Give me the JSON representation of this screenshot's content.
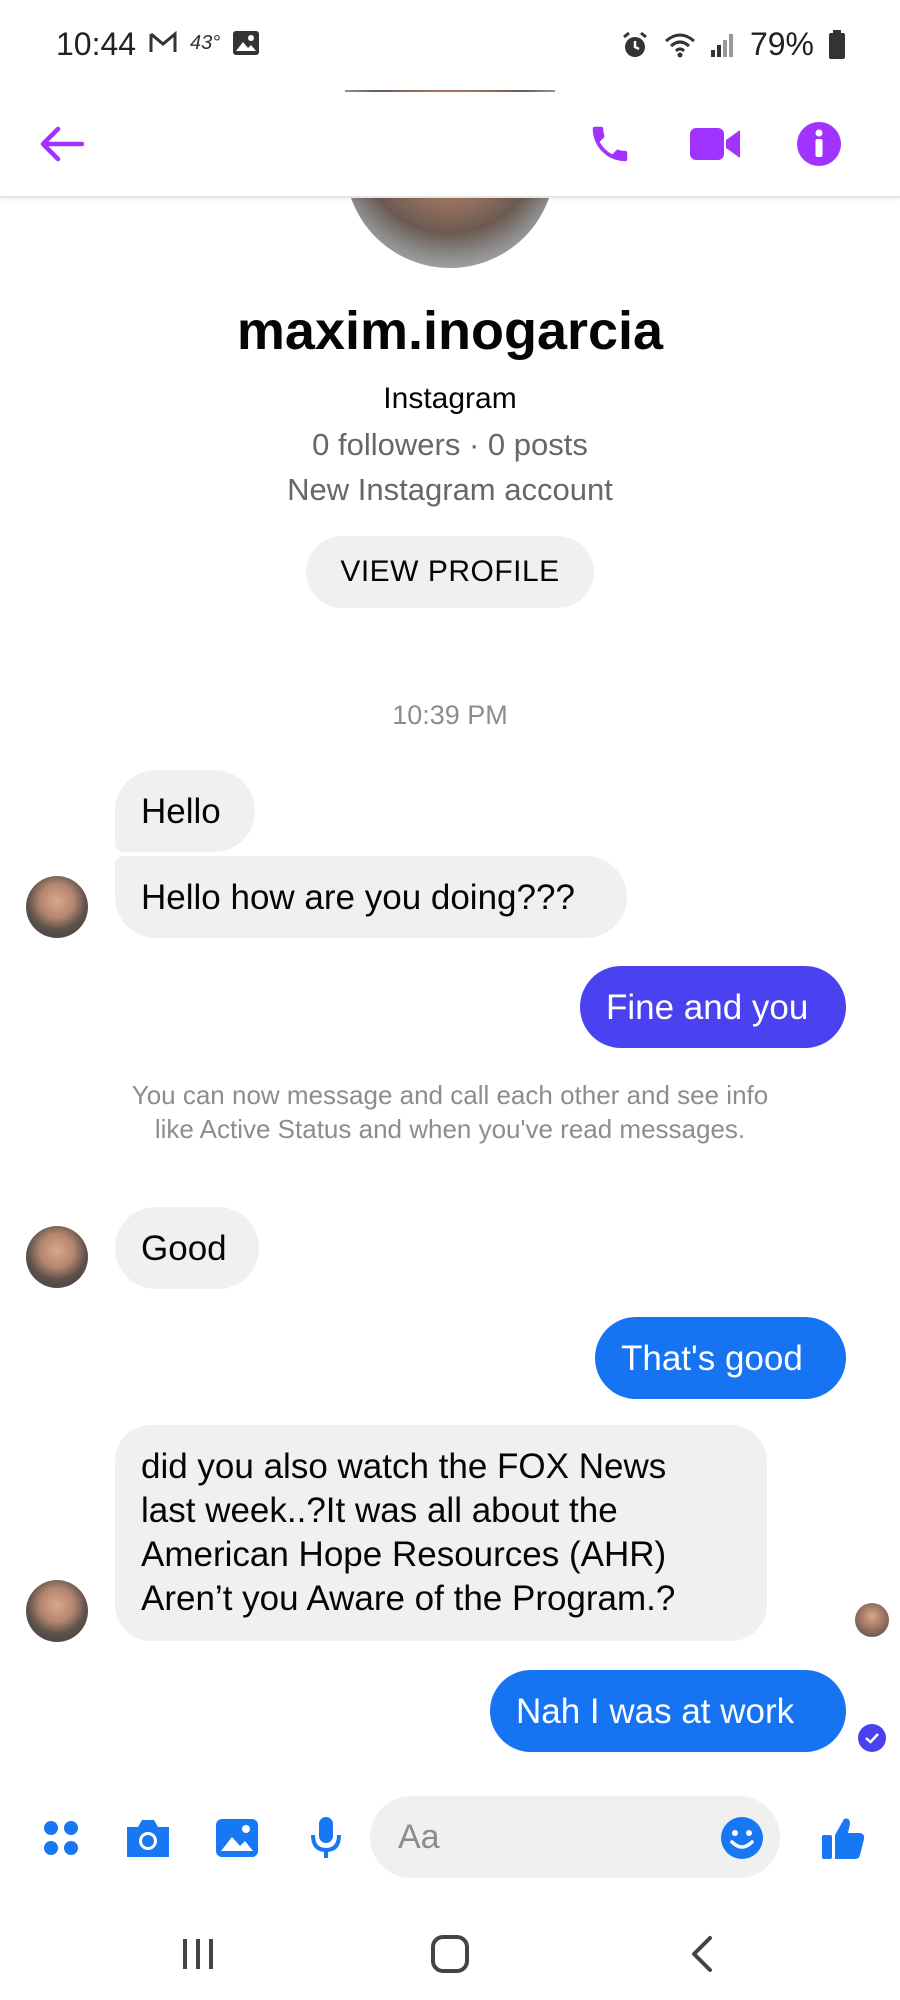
{
  "status_bar": {
    "time": "10:44",
    "temperature": "43°",
    "battery": "79%"
  },
  "header": {
    "icons": [
      "back-arrow-icon",
      "phone-icon",
      "video-icon",
      "info-icon"
    ],
    "accent_color": "#a033ff"
  },
  "profile": {
    "name": "maxim.inogarcia",
    "source": "Instagram",
    "stats": "0 followers · 0 posts",
    "description": "New Instagram account",
    "view_profile_label": "VIEW PROFILE"
  },
  "conversation": {
    "timestamp": "10:39 PM",
    "messages": [
      {
        "from": "them",
        "text": "Hello"
      },
      {
        "from": "them",
        "text": "Hello how are you doing???"
      },
      {
        "from": "me",
        "text": "Fine and you"
      },
      {
        "from": "system",
        "text": "You can now message and call each other and see info like Active Status and when you've read messages."
      },
      {
        "from": "them",
        "text": "Good"
      },
      {
        "from": "me",
        "text": "That's good"
      },
      {
        "from": "them",
        "lines": [
          "did you also watch the FOX News",
          "last week..?It was all about the",
          "American Hope Resources (AHR)",
          "Aren’t you Aware of the Program.?"
        ]
      },
      {
        "from": "me",
        "text": "Nah I was at work"
      }
    ],
    "outgoing_colors": [
      "#4a42f0",
      "#1673f2"
    ],
    "incoming_color": "#f0f0f0"
  },
  "composer": {
    "placeholder": "Aa",
    "icons": [
      "apps-icon",
      "camera-icon",
      "gallery-icon",
      "microphone-icon",
      "emoji-icon",
      "thumbs-up-icon"
    ],
    "accent_color": "#1877f2"
  },
  "nav_bar": {
    "icons": [
      "recent-apps-icon",
      "home-icon",
      "back-icon"
    ]
  }
}
